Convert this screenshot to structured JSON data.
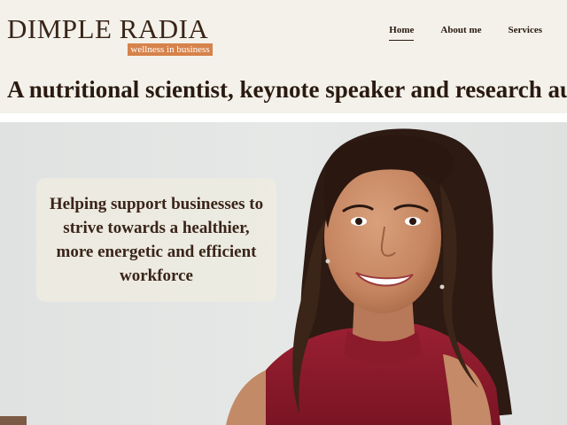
{
  "brand": {
    "name": "DIMPLE RADIA",
    "tagline": "wellness in business",
    "tagline_color": "#d6824a"
  },
  "nav": {
    "items": [
      {
        "label": "Home",
        "active": true
      },
      {
        "label": "About me",
        "active": false
      },
      {
        "label": "Services",
        "active": false
      }
    ]
  },
  "hero": {
    "headline": "A nutritional scientist, keynote speaker and research author",
    "callout": "Helping support businesses to strive towards a healthier, more energetic and efficient workforce",
    "image": "portrait-photo"
  },
  "colors": {
    "header_bg": "#f3f1ea",
    "text_dark": "#2a1a10",
    "hero_bg": "#e4e6e5",
    "top_color": "#8e1a2c"
  }
}
